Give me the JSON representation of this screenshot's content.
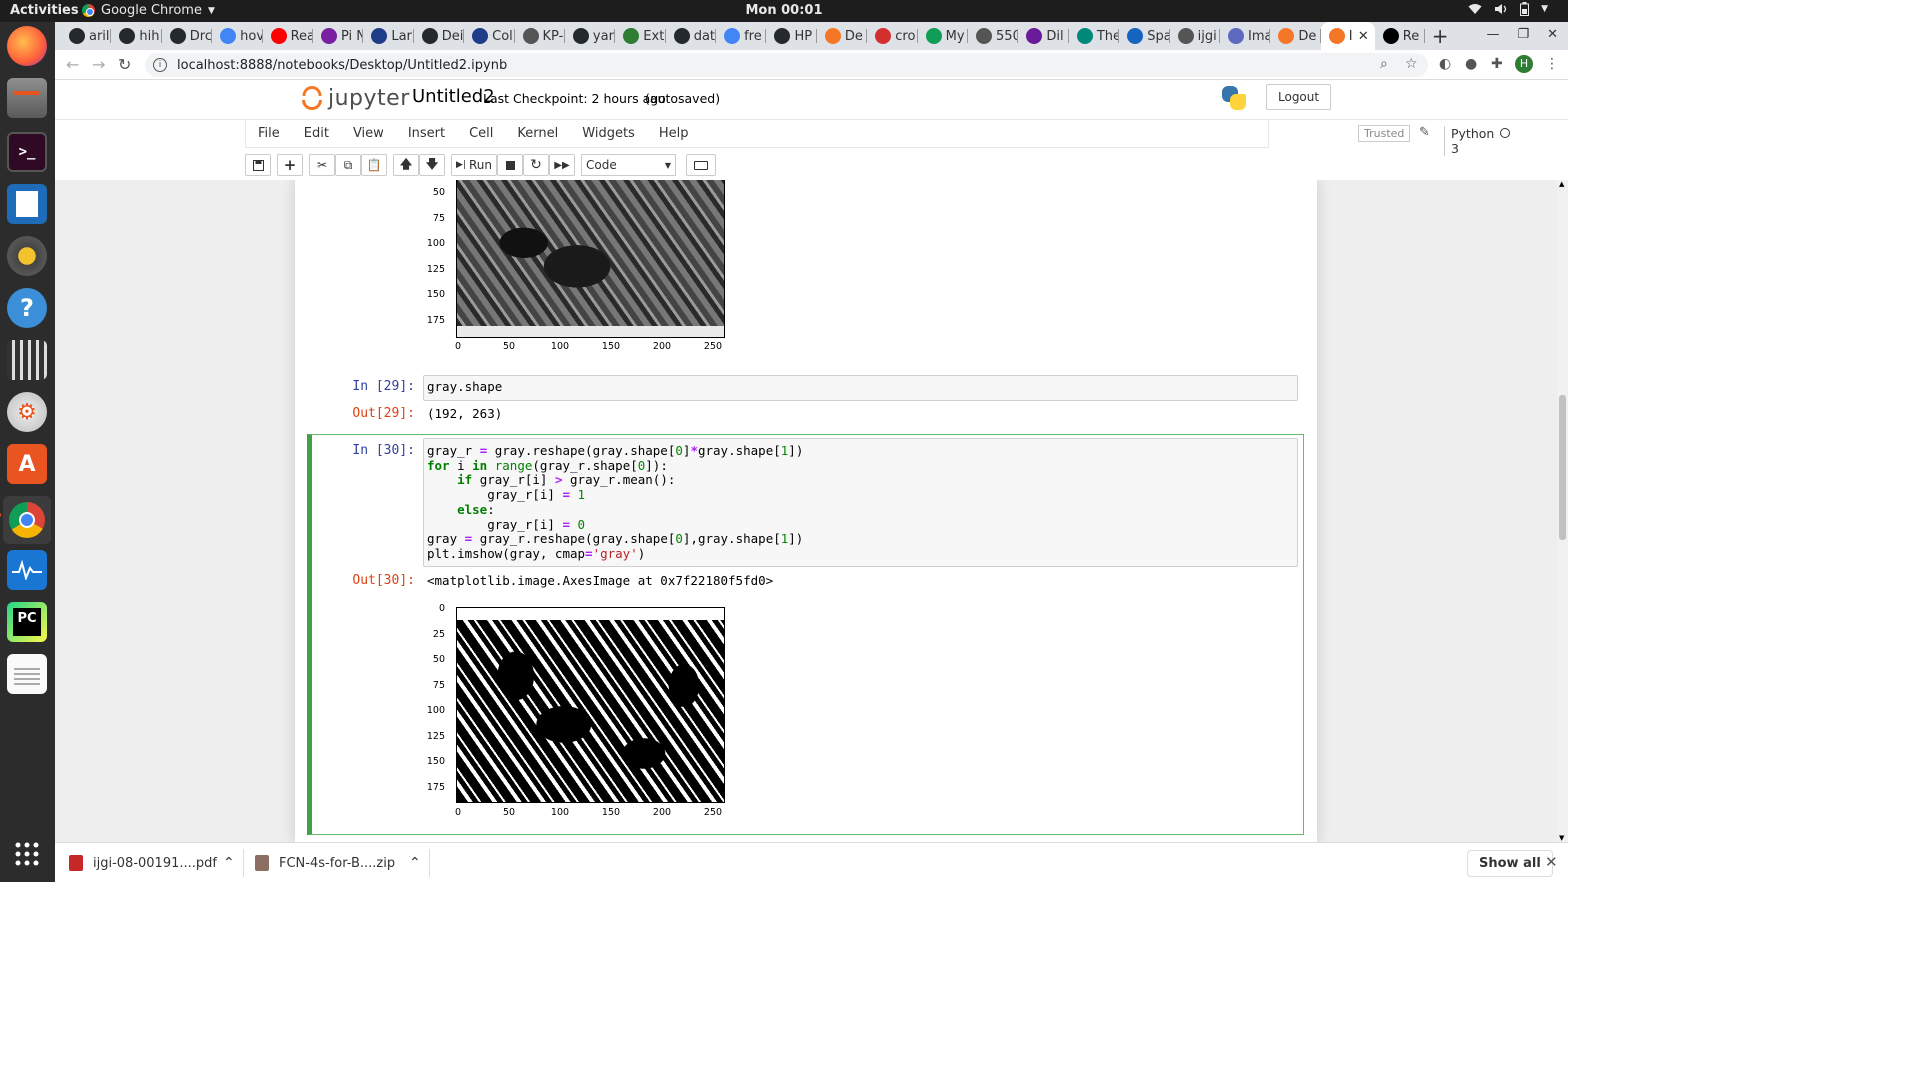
{
  "system": {
    "activities": "Activities",
    "app_menu": "Google Chrome",
    "clock": "Mon 00:01"
  },
  "browser": {
    "tabs": [
      {
        "label": "aril",
        "icon": "github-icon",
        "color": "#24292e"
      },
      {
        "label": "hih",
        "icon": "github-icon",
        "color": "#24292e"
      },
      {
        "label": "Drc",
        "icon": "github-icon",
        "color": "#24292e"
      },
      {
        "label": "hov",
        "icon": "google-icon",
        "color": "#4285f4"
      },
      {
        "label": "Rea",
        "icon": "youtube-icon",
        "color": "#ff0000"
      },
      {
        "label": "Pi N",
        "icon": "site-icon",
        "color": "#7b1fa2"
      },
      {
        "label": "Lar",
        "icon": "tds-icon",
        "color": "#1f3c88"
      },
      {
        "label": "Dei",
        "icon": "github-icon",
        "color": "#24292e"
      },
      {
        "label": "Col",
        "icon": "tds-icon",
        "color": "#1f3c88"
      },
      {
        "label": "KP-",
        "icon": "site-icon",
        "color": "#555555"
      },
      {
        "label": "yan",
        "icon": "github-icon",
        "color": "#24292e"
      },
      {
        "label": "Ext",
        "icon": "globe-icon",
        "color": "#2e7d32"
      },
      {
        "label": "dat",
        "icon": "github-icon",
        "color": "#24292e"
      },
      {
        "label": "fre",
        "icon": "google-icon",
        "color": "#4285f4"
      },
      {
        "label": "HP",
        "icon": "github-icon",
        "color": "#24292e"
      },
      {
        "label": "De",
        "icon": "jupyter-icon",
        "color": "#f37726"
      },
      {
        "label": "cro",
        "icon": "site-icon",
        "color": "#d32f2f"
      },
      {
        "label": "My",
        "icon": "drive-icon",
        "color": "#0f9d58"
      },
      {
        "label": "550",
        "icon": "site-icon",
        "color": "#555555"
      },
      {
        "label": "Dil",
        "icon": "site-icon",
        "color": "#6a1b9a"
      },
      {
        "label": "The",
        "icon": "site-icon",
        "color": "#00897b"
      },
      {
        "label": "Spa",
        "icon": "site-icon",
        "color": "#1565c0"
      },
      {
        "label": "ijgi",
        "icon": "site-icon",
        "color": "#555555"
      },
      {
        "label": "Ima",
        "icon": "chart-icon",
        "color": "#5c6bc0"
      },
      {
        "label": "De",
        "icon": "jupyter-icon",
        "color": "#f37726"
      },
      {
        "label": "I",
        "icon": "jupyter-icon",
        "color": "#f37726",
        "active": true
      },
      {
        "label": "Re",
        "icon": "medium-icon",
        "color": "#000000"
      }
    ],
    "url": "localhost:8888/notebooks/Desktop/Untitled2.ipynb",
    "profile_initial": "H"
  },
  "jupyter": {
    "logo_text": "jupyter",
    "notebook_name": "Untitled2",
    "checkpoint": "Last Checkpoint: 2 hours ago",
    "autosave": "(autosaved)",
    "logout": "Logout",
    "menu": [
      "File",
      "Edit",
      "View",
      "Insert",
      "Cell",
      "Kernel",
      "Widgets",
      "Help"
    ],
    "trusted": "Trusted",
    "kernel": "Python 3",
    "run_label": "Run",
    "cell_type": "Code"
  },
  "cells": {
    "c29": {
      "in_prompt": "In [29]:",
      "code": "gray.shape",
      "out_prompt": "Out[29]:",
      "output": "(192, 263)"
    },
    "c30": {
      "in_prompt": "In [30]:",
      "out_prompt": "Out[30]:",
      "output": "<matplotlib.image.AxesImage at 0x7f22180f5fd0>"
    }
  },
  "plots": {
    "top": {
      "y_ticks": [
        "50",
        "75",
        "100",
        "125",
        "150",
        "175"
      ],
      "x_ticks": [
        "0",
        "50",
        "100",
        "150",
        "200",
        "250"
      ]
    },
    "bottom": {
      "y_ticks": [
        "0",
        "25",
        "50",
        "75",
        "100",
        "125",
        "150",
        "175"
      ],
      "x_ticks": [
        "0",
        "50",
        "100",
        "150",
        "200",
        "250"
      ]
    }
  },
  "downloads": {
    "items": [
      {
        "name": "ijgi-08-00191....pdf",
        "icon": "pdf-icon",
        "color": "#c62828"
      },
      {
        "name": "FCN-4s-for-B....zip",
        "icon": "zip-icon",
        "color": "#8d6e63"
      }
    ],
    "show_all": "Show all"
  }
}
